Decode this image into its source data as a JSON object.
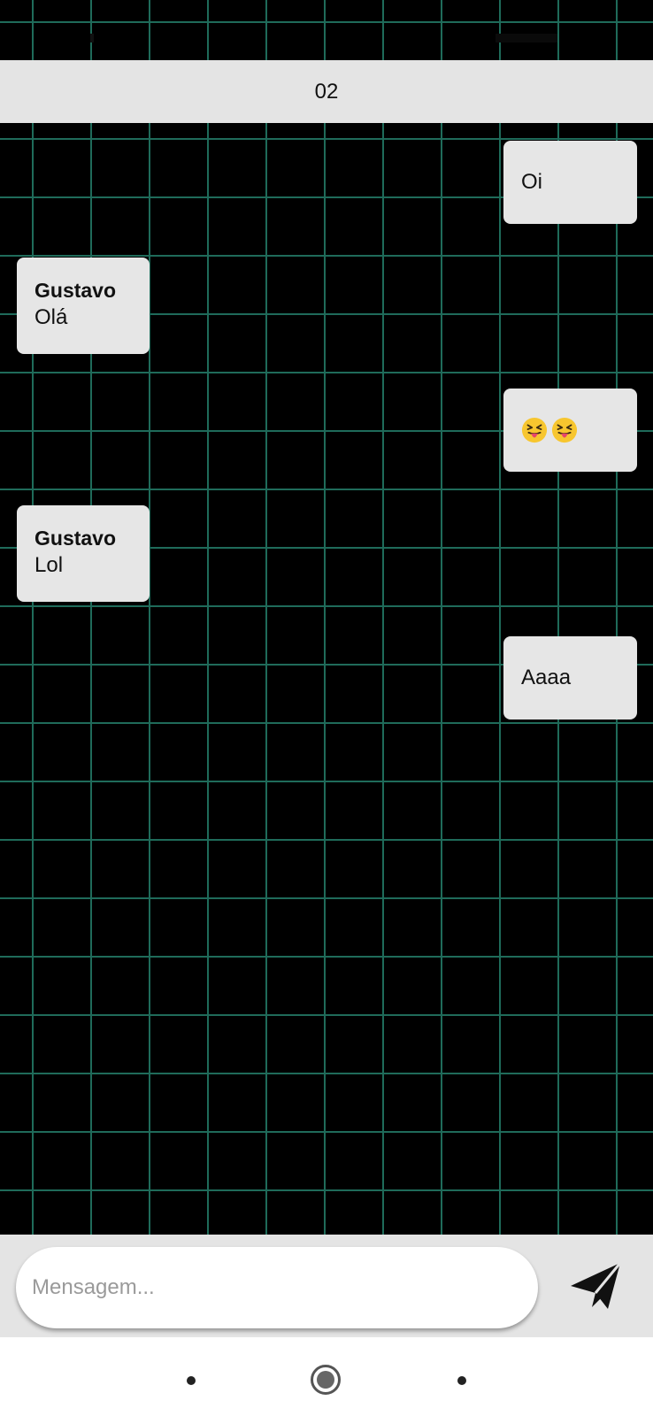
{
  "header": {
    "title": "02"
  },
  "messages": [
    {
      "direction": "outgoing",
      "text": "Oi"
    },
    {
      "direction": "incoming",
      "sender": "Gustavo",
      "text": "Olá"
    },
    {
      "direction": "outgoing",
      "emoji": [
        "squinting-face-with-tongue",
        "squinting-face-with-tongue"
      ]
    },
    {
      "direction": "incoming",
      "sender": "Gustavo",
      "text": "Lol"
    },
    {
      "direction": "outgoing",
      "text": "Aaaa"
    }
  ],
  "composer": {
    "placeholder": "Mensagem...",
    "value": "",
    "send_icon": "send-icon"
  },
  "nav_bar": {
    "icons": [
      "back-icon",
      "home-icon",
      "recents-icon"
    ]
  },
  "colors": {
    "background": "#000000",
    "grid_line": "#1f6b5a",
    "bubble": "#e6e6e6",
    "header_bar": "#e4e4e4"
  }
}
